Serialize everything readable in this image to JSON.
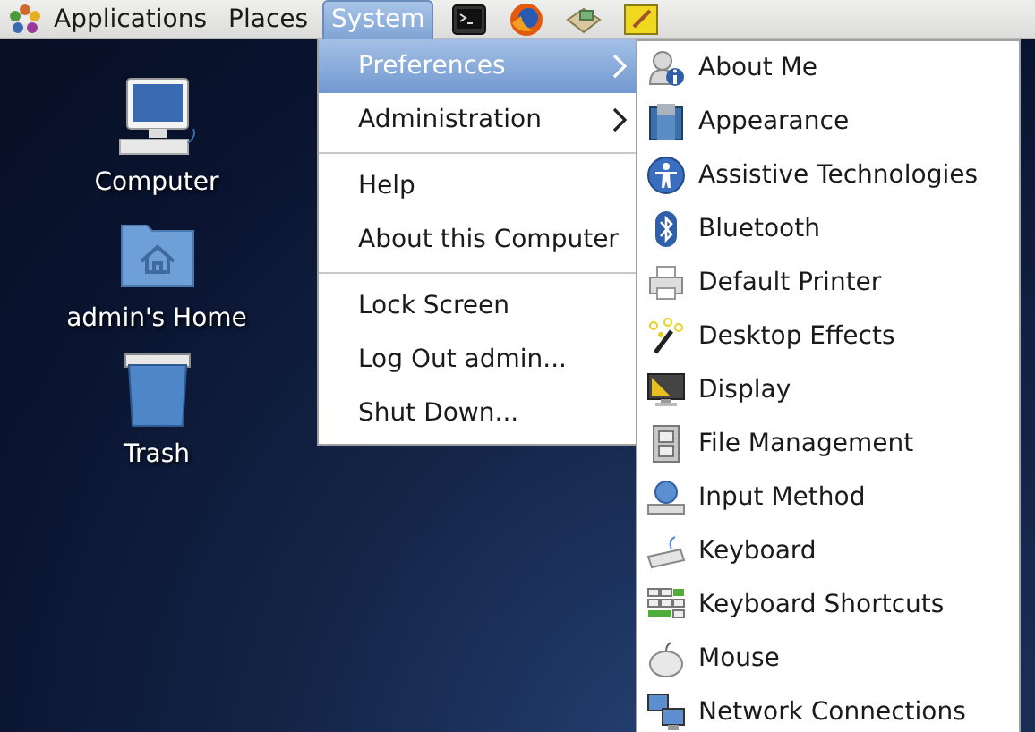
{
  "panel": {
    "menus": [
      {
        "label": "Applications",
        "selected": false
      },
      {
        "label": "Places",
        "selected": false
      },
      {
        "label": "System",
        "selected": true
      }
    ]
  },
  "desktop_icons": [
    {
      "label": "Computer"
    },
    {
      "label": "admin's Home"
    },
    {
      "label": "Trash"
    }
  ],
  "system_menu": {
    "items": [
      {
        "kind": "item",
        "label": "Preferences",
        "selected": true,
        "has_submenu": true
      },
      {
        "kind": "item",
        "label": "Administration",
        "selected": false,
        "has_submenu": true
      },
      {
        "kind": "separator"
      },
      {
        "kind": "item",
        "label": "Help",
        "selected": false,
        "has_submenu": false
      },
      {
        "kind": "item",
        "label": "About this Computer",
        "selected": false,
        "has_submenu": false
      },
      {
        "kind": "separator"
      },
      {
        "kind": "item",
        "label": "Lock Screen",
        "selected": false,
        "has_submenu": false
      },
      {
        "kind": "item",
        "label": "Log Out admin...",
        "selected": false,
        "has_submenu": false
      },
      {
        "kind": "item",
        "label": "Shut Down...",
        "selected": false,
        "has_submenu": false
      }
    ]
  },
  "preferences_submenu": {
    "items": [
      {
        "label": "About Me"
      },
      {
        "label": "Appearance"
      },
      {
        "label": "Assistive Technologies"
      },
      {
        "label": "Bluetooth"
      },
      {
        "label": "Default Printer"
      },
      {
        "label": "Desktop Effects"
      },
      {
        "label": "Display"
      },
      {
        "label": "File Management"
      },
      {
        "label": "Input Method"
      },
      {
        "label": "Keyboard"
      },
      {
        "label": "Keyboard Shortcuts"
      },
      {
        "label": "Mouse"
      },
      {
        "label": "Network Connections"
      }
    ]
  }
}
